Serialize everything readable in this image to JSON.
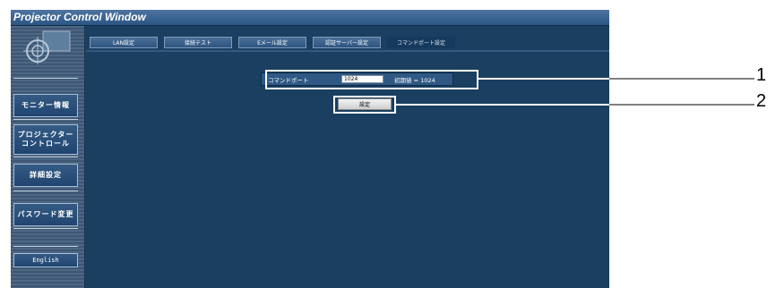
{
  "window": {
    "title": "Projector Control Window"
  },
  "sidebar": {
    "items": [
      {
        "label": "モニター情報"
      },
      {
        "label": "プロジェクター\nコントロール"
      },
      {
        "label": "詳細設定"
      },
      {
        "label": "パスワード変更"
      }
    ],
    "language_button": "English"
  },
  "tabs": [
    {
      "label": "LAN設定"
    },
    {
      "label": "接続テスト"
    },
    {
      "label": "Eメール設定"
    },
    {
      "label": "認証サーバー設定"
    },
    {
      "label": "コマンドポート設定"
    }
  ],
  "active_tab": "コマンドポート設定",
  "form": {
    "port_label": "コマンドポート",
    "port_value": "1024",
    "default_label": "初期値 = 1024",
    "set_button": "設定"
  },
  "callouts": [
    "1",
    "2"
  ],
  "colors": {
    "background": "#1a3f60",
    "callout_border": "#ffffff",
    "title_text": "#ffffff"
  }
}
